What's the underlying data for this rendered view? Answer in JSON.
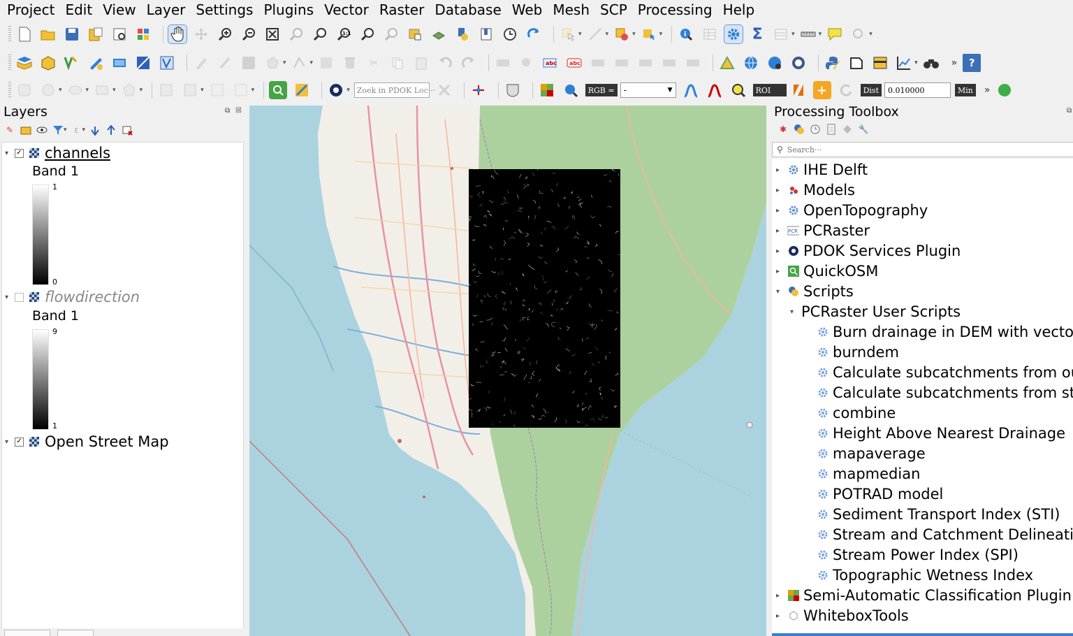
{
  "menubar": [
    "Project",
    "Edit",
    "View",
    "Layer",
    "Settings",
    "Plugins",
    "Vector",
    "Raster",
    "Database",
    "Web",
    "Mesh",
    "SCP",
    "Processing",
    "Help"
  ],
  "toolbar3": {
    "pdok_search_placeholder": "Zoek in PDOK Loc···",
    "rgb_label": "RGB =",
    "rgb_value": "-",
    "roi_label": "ROI",
    "dist_label": "Dist",
    "dist_value": "0.010000",
    "min_label": "Min"
  },
  "layers_panel": {
    "title": "Layers",
    "layers": [
      {
        "name": "channels",
        "checked": true,
        "band_label": "Band 1",
        "ramp_max": "1",
        "ramp_min": "0"
      },
      {
        "name": "flowdirection",
        "checked": false,
        "band_label": "Band 1",
        "ramp_max": "9",
        "ramp_min": "1"
      },
      {
        "name": "Open Street Map",
        "checked": true
      }
    ]
  },
  "toolbox": {
    "title": "Processing Toolbox",
    "search_placeholder": "Search···",
    "items": [
      {
        "label": "IHE Delft",
        "icon": "gear-icon"
      },
      {
        "label": "Models",
        "icon": "models-icon"
      },
      {
        "label": "OpenTopography",
        "icon": "gear-icon"
      },
      {
        "label": "PCRaster",
        "icon": "pcraster-icon"
      },
      {
        "label": "PDOK Services Plugin",
        "icon": "pdok-icon"
      },
      {
        "label": "QuickOSM",
        "icon": "quickosm-icon"
      },
      {
        "label": "Scripts",
        "icon": "python-icon"
      },
      {
        "label": "PCRaster User Scripts"
      },
      {
        "label": "Burn drainage in DEM with vector..."
      },
      {
        "label": "burndem"
      },
      {
        "label": "Calculate subcatchments from ou..."
      },
      {
        "label": "Calculate subcatchments from str..."
      },
      {
        "label": "combine"
      },
      {
        "label": "Height Above Nearest Drainage"
      },
      {
        "label": "mapaverage"
      },
      {
        "label": "mapmedian"
      },
      {
        "label": "POTRAD model"
      },
      {
        "label": "Sediment Transport Index (STI)"
      },
      {
        "label": "Stream and Catchment Delineation"
      },
      {
        "label": "Stream Power Index (SPI)"
      },
      {
        "label": "Topographic Wetness Index"
      },
      {
        "label": "Semi-Automatic Classification Plugin",
        "icon": "scp-icon"
      },
      {
        "label": "WhiteboxTools",
        "icon": "whitebox-icon"
      }
    ]
  },
  "colors": {
    "sea": "#aad3df",
    "land": "#f2efe9",
    "forest": "#add19e",
    "raster": "#000000",
    "selection": "#3c7fd1"
  }
}
